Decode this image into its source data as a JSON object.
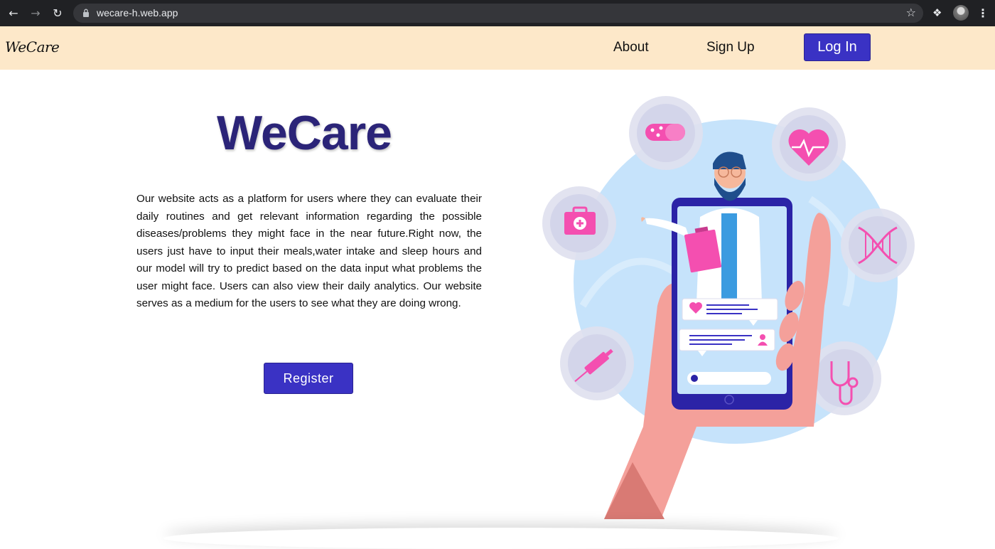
{
  "browser": {
    "url": "wecare-h.web.app",
    "back_icon": "arrow-left-icon",
    "forward_icon": "arrow-right-icon",
    "reload_icon": "reload-icon"
  },
  "header": {
    "brand": "WeCare",
    "nav": {
      "about": "About",
      "signup": "Sign Up",
      "login": "Log In"
    }
  },
  "hero": {
    "title": "WeCare",
    "description": "Our website acts as a platform for users where they can evaluate their daily routines and get relevant information regarding the possible diseases/problems they might face in the near future.Right now, the users just have to input their meals,water intake and sleep hours and our model will try to predict based on the data input what problems the user might face. Users can also view their daily analytics. Our website serves as a medium for the users to see what they are doing wrong.",
    "register": "Register"
  },
  "colors": {
    "header_bg": "#fde8c9",
    "accent": "#3a32c4",
    "title": "#2b2478",
    "pink": "#f44fb0"
  }
}
